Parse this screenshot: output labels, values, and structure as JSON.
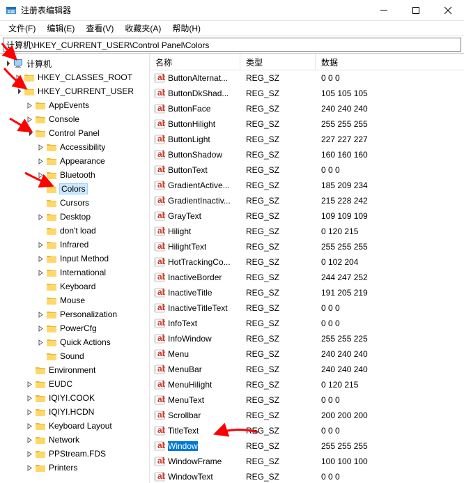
{
  "window": {
    "title": "注册表编辑器"
  },
  "menu": {
    "file": "文件(F)",
    "edit": "编辑(E)",
    "view": "查看(V)",
    "favorites": "收藏夹(A)",
    "help": "帮助(H)"
  },
  "address": {
    "value": "计算机\\HKEY_CURRENT_USER\\Control Panel\\Colors"
  },
  "tree": {
    "root": "计算机",
    "hives": [
      {
        "label": "HKEY_CLASSES_ROOT",
        "expanded": false
      },
      {
        "label": "HKEY_CURRENT_USER",
        "expanded": true,
        "children": [
          {
            "label": "AppEvents"
          },
          {
            "label": "Console"
          },
          {
            "label": "Control Panel",
            "expanded": true,
            "children": [
              {
                "label": "Accessibility"
              },
              {
                "label": "Appearance"
              },
              {
                "label": "Bluetooth"
              },
              {
                "label": "Colors",
                "selected": true,
                "leaf": true
              },
              {
                "label": "Cursors",
                "leaf": true
              },
              {
                "label": "Desktop"
              },
              {
                "label": "don't load",
                "leaf": true
              },
              {
                "label": "Infrared"
              },
              {
                "label": "Input Method"
              },
              {
                "label": "International"
              },
              {
                "label": "Keyboard",
                "leaf": true
              },
              {
                "label": "Mouse",
                "leaf": true
              },
              {
                "label": "Personalization"
              },
              {
                "label": "PowerCfg"
              },
              {
                "label": "Quick Actions"
              },
              {
                "label": "Sound",
                "leaf": true
              }
            ]
          },
          {
            "label": "Environment",
            "leaf": true
          },
          {
            "label": "EUDC"
          },
          {
            "label": "IQIYI.COOK"
          },
          {
            "label": "IQIYI.HCDN"
          },
          {
            "label": "Keyboard Layout"
          },
          {
            "label": "Network"
          },
          {
            "label": "PPStream.FDS"
          },
          {
            "label": "Printers"
          }
        ]
      }
    ]
  },
  "list": {
    "columns": {
      "name": "名称",
      "type": "类型",
      "data": "数据"
    },
    "rows": [
      {
        "name": "ButtonAlternat...",
        "type": "REG_SZ",
        "data": "0 0 0"
      },
      {
        "name": "ButtonDkShad...",
        "type": "REG_SZ",
        "data": "105 105 105"
      },
      {
        "name": "ButtonFace",
        "type": "REG_SZ",
        "data": "240 240 240"
      },
      {
        "name": "ButtonHilight",
        "type": "REG_SZ",
        "data": "255 255 255"
      },
      {
        "name": "ButtonLight",
        "type": "REG_SZ",
        "data": "227 227 227"
      },
      {
        "name": "ButtonShadow",
        "type": "REG_SZ",
        "data": "160 160 160"
      },
      {
        "name": "ButtonText",
        "type": "REG_SZ",
        "data": "0 0 0"
      },
      {
        "name": "GradientActive...",
        "type": "REG_SZ",
        "data": "185 209 234"
      },
      {
        "name": "GradientInactiv...",
        "type": "REG_SZ",
        "data": "215 228 242"
      },
      {
        "name": "GrayText",
        "type": "REG_SZ",
        "data": "109 109 109"
      },
      {
        "name": "Hilight",
        "type": "REG_SZ",
        "data": "0 120 215"
      },
      {
        "name": "HilightText",
        "type": "REG_SZ",
        "data": "255 255 255"
      },
      {
        "name": "HotTrackingCo...",
        "type": "REG_SZ",
        "data": "0 102 204"
      },
      {
        "name": "InactiveBorder",
        "type": "REG_SZ",
        "data": "244 247 252"
      },
      {
        "name": "InactiveTitle",
        "type": "REG_SZ",
        "data": "191 205 219"
      },
      {
        "name": "InactiveTitleText",
        "type": "REG_SZ",
        "data": "0 0 0"
      },
      {
        "name": "InfoText",
        "type": "REG_SZ",
        "data": "0 0 0"
      },
      {
        "name": "InfoWindow",
        "type": "REG_SZ",
        "data": "255 255 225"
      },
      {
        "name": "Menu",
        "type": "REG_SZ",
        "data": "240 240 240"
      },
      {
        "name": "MenuBar",
        "type": "REG_SZ",
        "data": "240 240 240"
      },
      {
        "name": "MenuHilight",
        "type": "REG_SZ",
        "data": "0 120 215"
      },
      {
        "name": "MenuText",
        "type": "REG_SZ",
        "data": "0 0 0"
      },
      {
        "name": "Scrollbar",
        "type": "REG_SZ",
        "data": "200 200 200"
      },
      {
        "name": "TitleText",
        "type": "REG_SZ",
        "data": "0 0 0"
      },
      {
        "name": "Window",
        "type": "REG_SZ",
        "data": "255 255 255",
        "selected": true
      },
      {
        "name": "WindowFrame",
        "type": "REG_SZ",
        "data": "100 100 100"
      },
      {
        "name": "WindowText",
        "type": "REG_SZ",
        "data": "0 0 0"
      }
    ]
  }
}
